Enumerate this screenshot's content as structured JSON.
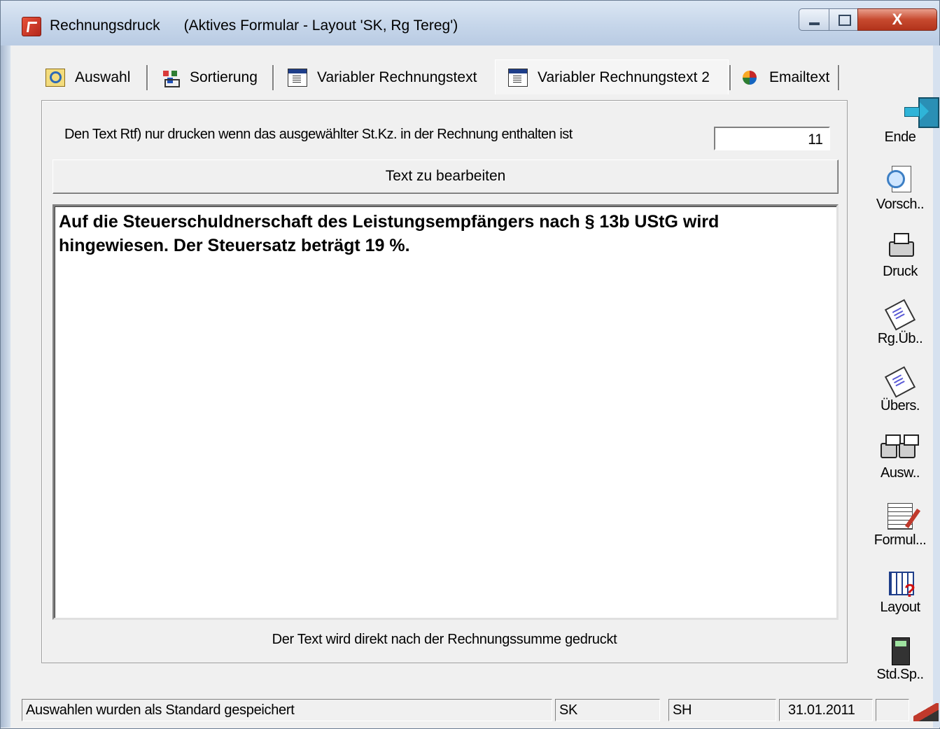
{
  "window": {
    "title": "Rechnungsdruck",
    "subtitle": "(Aktives Formular - Layout 'SK, Rg Tereg')",
    "close_glyph": "X"
  },
  "tabs": [
    {
      "label": "Auswahl",
      "icon": "search-folder-icon",
      "active": false
    },
    {
      "label": "Sortierung",
      "icon": "sort-icon",
      "active": false
    },
    {
      "label": "Variabler Rechnungstext",
      "icon": "document-icon",
      "active": false
    },
    {
      "label": "Variabler Rechnungstext 2",
      "icon": "document-icon",
      "active": true
    },
    {
      "label": "Emailtext",
      "icon": "email-icon",
      "active": false
    }
  ],
  "page": {
    "condition_label": "Den Text Rtf) nur drucken wenn das ausgewählter St.Kz. in der Rechnung enthalten ist",
    "stkz_value": "11",
    "edit_button": "Text zu bearbeiten",
    "rtf_text": "Auf die Steuerschuldnerschaft des Leistungsempfängers nach § 13b UStG wird hingewiesen. Der Steuersatz beträgt 19 %.",
    "footer_note": "Der  Text wird direkt nach der Rechnungssumme gedruckt"
  },
  "toolbar": [
    {
      "label": "Ende",
      "icon": "exit-door-icon"
    },
    {
      "label": "Vorsch..",
      "icon": "preview-icon"
    },
    {
      "label": "Druck",
      "icon": "printer-icon"
    },
    {
      "label": "Rg.Üb..",
      "icon": "invoice-overview-icon"
    },
    {
      "label": "Übers.",
      "icon": "overview-icon"
    },
    {
      "label": "Ausw..",
      "icon": "multi-printer-icon"
    },
    {
      "label": "Formul...",
      "icon": "form-edit-icon"
    },
    {
      "label": "Layout",
      "icon": "layout-help-icon"
    },
    {
      "label": "Std.Sp..",
      "icon": "save-default-icon"
    }
  ],
  "statusbar": {
    "message": "Auswahlen wurden als Standard gespeichert",
    "field1": "SK",
    "field2": "SH",
    "date": "31.01.2011",
    "field4": ""
  },
  "colors": {
    "titlebar": "#c6d6ea",
    "close_button": "#c74a2f",
    "window_bg": "#f0f0f0"
  }
}
